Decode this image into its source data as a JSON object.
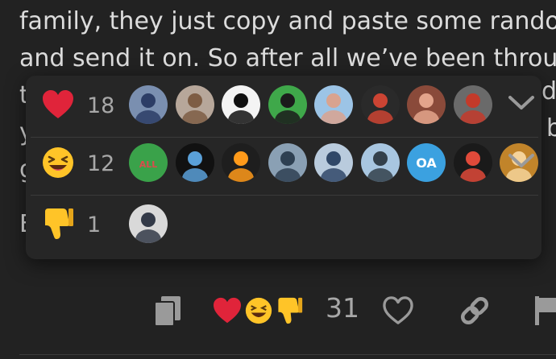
{
  "post": {
    "lines": [
      "family, they just copy and paste some rando",
      "and send it on. So after all we’ve been throu",
      "t",
      "y",
      "g",
      "E"
    ],
    "right_fragments": [
      "ds",
      "b"
    ]
  },
  "reactions": [
    {
      "emoji": "heart-icon",
      "count": "18",
      "avatars": [
        {
          "name": "avatar-robot-figure",
          "bg": "#7a8fb0",
          "fg": "#2c3d66"
        },
        {
          "name": "avatar-hamster",
          "bg": "#b7a79a",
          "fg": "#7e5d44"
        },
        {
          "name": "avatar-emblem-white",
          "bg": "#f4f4f4",
          "fg": "#111111"
        },
        {
          "name": "avatar-green-car",
          "bg": "#3fa84a",
          "fg": "#1b1b1b"
        },
        {
          "name": "avatar-person-cap",
          "bg": "#9cc4e6",
          "fg": "#d9a38f"
        },
        {
          "name": "avatar-devolution",
          "bg": "#2a2a2a",
          "fg": "#cc4433"
        },
        {
          "name": "avatar-cow-glasses",
          "bg": "#8a4a3a",
          "fg": "#e3a48c"
        },
        {
          "name": "avatar-red-robot",
          "bg": "#6a6a6a",
          "fg": "#c33a2a"
        }
      ]
    },
    {
      "emoji": "laughing-face-icon",
      "count": "12",
      "avatars": [
        {
          "name": "avatar-cartoon-rainbow",
          "bg": "#3aa24a",
          "fg": "#d94c4c",
          "label": "ALL"
        },
        {
          "name": "avatar-dark-logo",
          "bg": "#111111",
          "fg": "#5aa0d8"
        },
        {
          "name": "avatar-orange-ring",
          "bg": "#1e1e1e",
          "fg": "#ff9a1a"
        },
        {
          "name": "avatar-landscape",
          "bg": "#8aa0b4",
          "fg": "#2e4052"
        },
        {
          "name": "avatar-man-blue",
          "bg": "#b9cbdd",
          "fg": "#304868"
        },
        {
          "name": "avatar-goose",
          "bg": "#a8c6e0",
          "fg": "#33404a"
        },
        {
          "name": "avatar-oa-initials",
          "bg": "#3ba1e0",
          "fg": "#ffffff",
          "label": "OA"
        },
        {
          "name": "avatar-circuit",
          "bg": "#1a1a1a",
          "fg": "#e04a3a"
        },
        {
          "name": "avatar-link-character",
          "bg": "#c1842a",
          "fg": "#f5d39a"
        }
      ]
    },
    {
      "emoji": "thumbs-down-icon",
      "count": "1",
      "avatars": [
        {
          "name": "avatar-man-suit",
          "bg": "#d9d9d9",
          "fg": "#333a48"
        }
      ]
    }
  ],
  "actions": {
    "likes_count": "31"
  },
  "colors": {
    "heart": "#e0243a",
    "emoji_yellow": "#ffc428",
    "muted": "#a8a8a8"
  }
}
